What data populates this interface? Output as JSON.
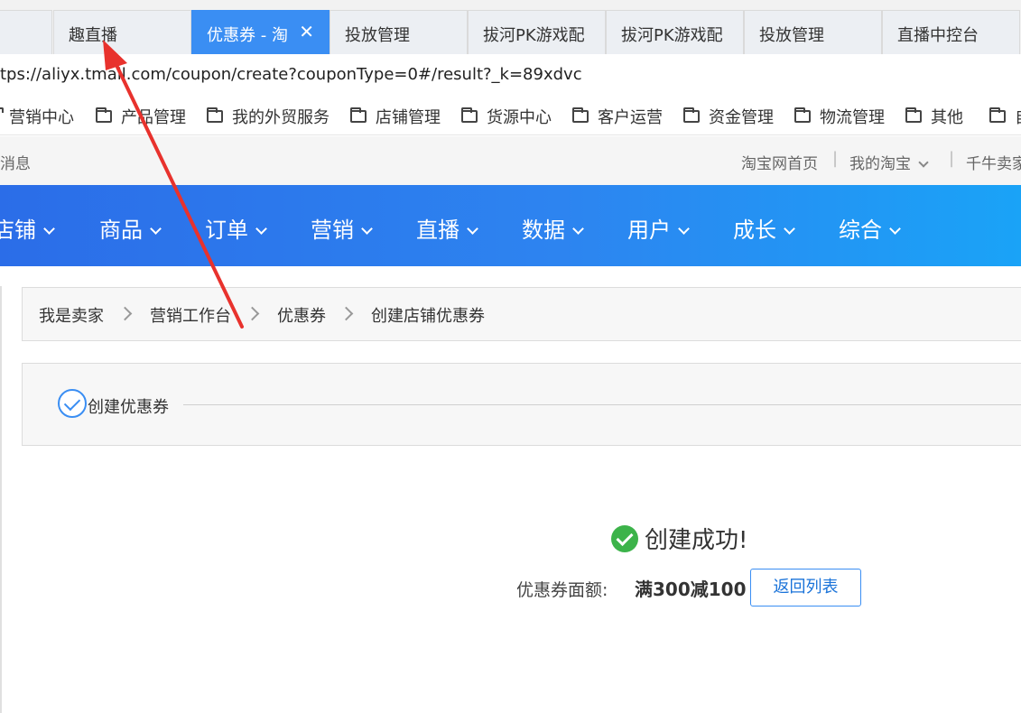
{
  "tabs": [
    {
      "label": ""
    },
    {
      "label": "趣直播"
    },
    {
      "label": "优惠券 - 淘"
    },
    {
      "label": "投放管理"
    },
    {
      "label": "拔河PK游戏配"
    },
    {
      "label": "拔河PK游戏配"
    },
    {
      "label": "投放管理"
    },
    {
      "label": "直播中控台"
    }
  ],
  "address": {
    "url": "tps://aliyx.tmall.com/coupon/create?couponType=0#/result?_k=89xdvc"
  },
  "bookmarks": [
    "营销中心",
    "产品管理",
    "我的外贸服务",
    "店铺管理",
    "货源中心",
    "客户运营",
    "资金管理",
    "物流管理",
    "其他",
    "自"
  ],
  "infobar": {
    "left": "消息",
    "links": [
      "淘宝网首页",
      "我的淘宝",
      "千牛卖家"
    ]
  },
  "nav": [
    "店铺",
    "商品",
    "订单",
    "营销",
    "直播",
    "数据",
    "用户",
    "成长",
    "综合"
  ],
  "breadcrumb": [
    "我是卖家",
    "营销工作台",
    "优惠券",
    "创建店铺优惠券"
  ],
  "steps": {
    "label": "创建优惠券"
  },
  "result": {
    "title": "创建成功!",
    "face_value_label": "优惠券面额:",
    "face_value": "满300减100",
    "return_button": "返回列表"
  },
  "colors": {
    "accent": "#3a8ef3",
    "success": "#3cb34a",
    "annotation": "#e8322d"
  }
}
